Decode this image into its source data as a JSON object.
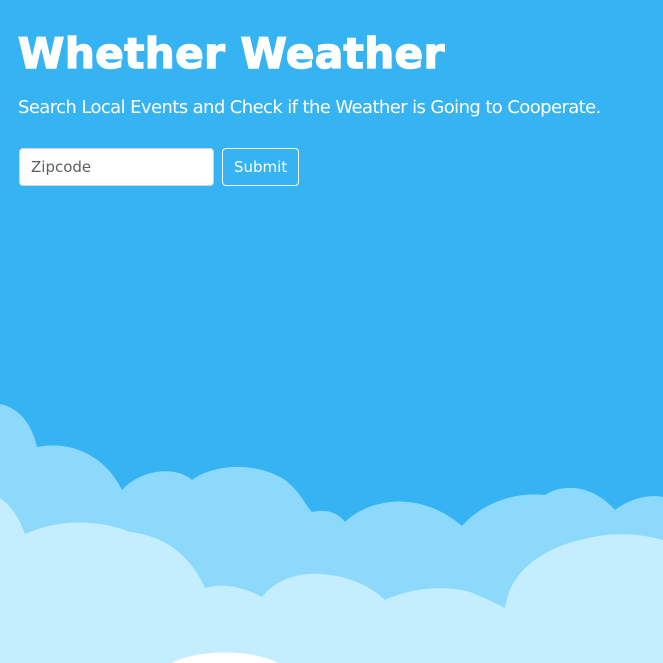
{
  "header": {
    "title": "Whether Weather",
    "subtitle": "Search Local Events and Check if the Weather is Going to Cooperate."
  },
  "search": {
    "placeholder": "Zipcode",
    "value": "",
    "submit_label": "Submit"
  },
  "colors": {
    "sky": "#36b3f3",
    "cloud_back": "#8dd9fb",
    "cloud_front": "#c4eefe",
    "cloud_highlight": "#ffffff"
  }
}
